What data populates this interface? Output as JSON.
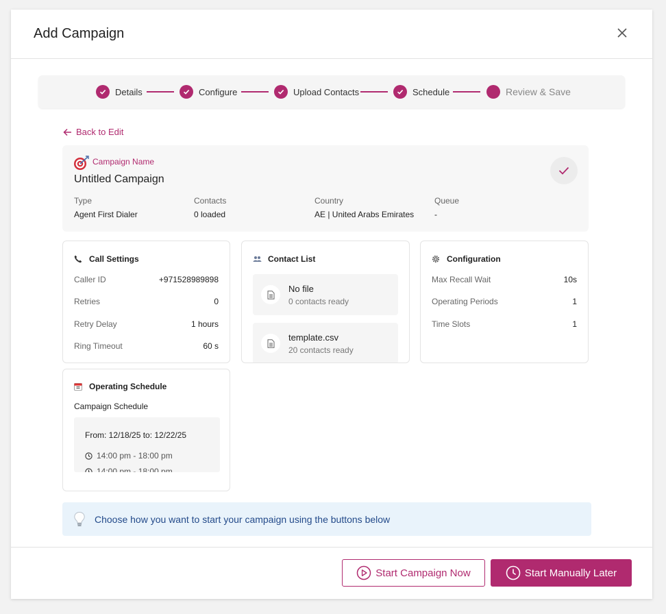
{
  "modal": {
    "title": "Add Campaign"
  },
  "stepper": {
    "steps": [
      {
        "label": "Details"
      },
      {
        "label": "Configure"
      },
      {
        "label": "Upload Contacts"
      },
      {
        "label": "Schedule"
      },
      {
        "label": "Review & Save"
      }
    ]
  },
  "back_link": "Back to Edit",
  "summary": {
    "name_label": "Campaign Name",
    "name": "Untitled Campaign",
    "meta": [
      {
        "key": "Type",
        "value": "Agent First Dialer"
      },
      {
        "key": "Contacts",
        "value": "0  loaded"
      },
      {
        "key": "Country",
        "value": "AE | United Arabs Emirates"
      },
      {
        "key": "Queue",
        "value": "-"
      }
    ]
  },
  "call_settings": {
    "title": "Call Settings",
    "rows": [
      {
        "key": "Caller ID",
        "value": "+971528989898"
      },
      {
        "key": "Retries",
        "value": "0"
      },
      {
        "key": "Retry Delay",
        "value": "1 hours"
      },
      {
        "key": "Ring Timeout",
        "value": "60 s"
      }
    ]
  },
  "contact_list": {
    "title": "Contact List",
    "files": [
      {
        "name": "No file",
        "count": "0 contacts ready"
      },
      {
        "name": "template.csv",
        "count": "20   contacts ready"
      }
    ]
  },
  "configuration": {
    "title": "Configuration",
    "rows": [
      {
        "key": "Max Recall Wait",
        "value": "10s"
      },
      {
        "key": "Operating Periods",
        "value": "1"
      },
      {
        "key": "Time Slots",
        "value": "1"
      }
    ]
  },
  "operating_schedule": {
    "title": "Operating Schedule",
    "subtitle": "Campaign Schedule",
    "range": "From:  12/18/25  to: 12/22/25",
    "slots": [
      "14:00 pm - 18:00 pm",
      "14:00 pm - 18:00 pm"
    ]
  },
  "tip": {
    "text": "Choose how you want to start your campaign using the buttons below"
  },
  "footer": {
    "start_now": "Start Campaign Now",
    "start_later": "Start Manually Later"
  },
  "colors": {
    "accent": "#b02a6f",
    "tip_bg": "#e9f3fb",
    "tip_text": "#234a8a"
  }
}
